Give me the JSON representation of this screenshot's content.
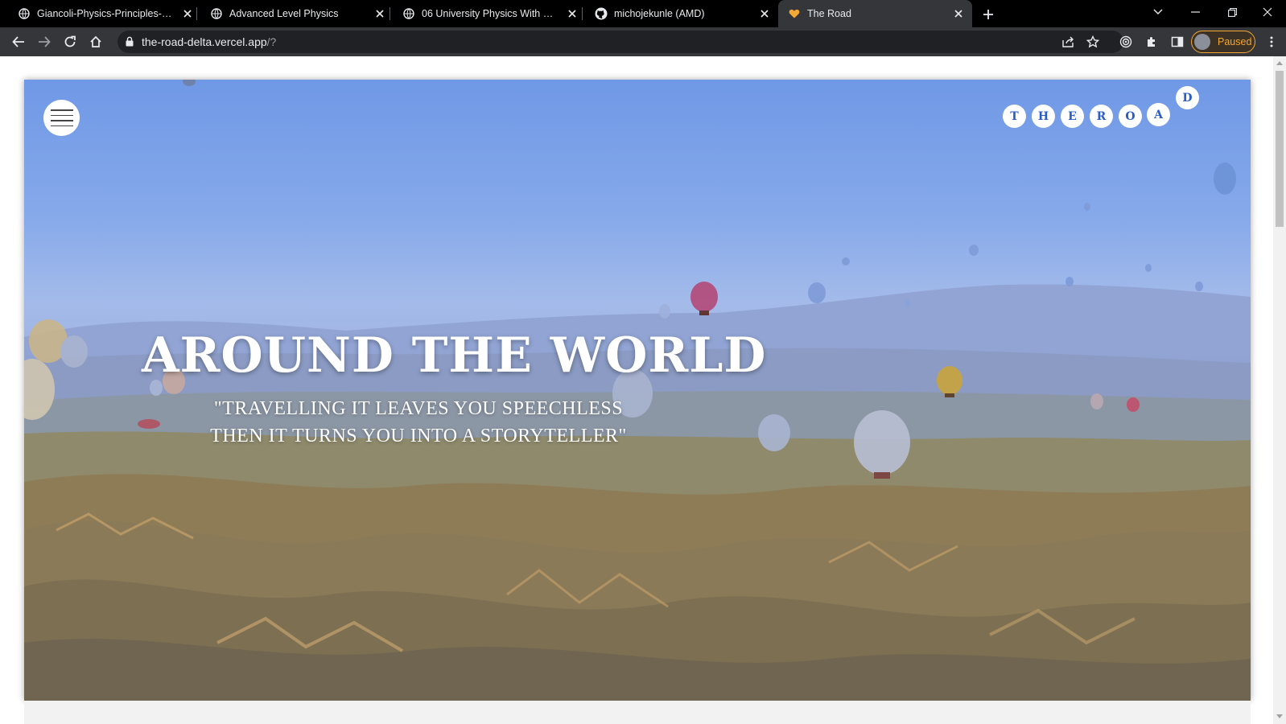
{
  "browser": {
    "tabs": [
      {
        "title": "Giancoli-Physics-Principles-with-",
        "icon": "globe-icon",
        "active": false
      },
      {
        "title": "Advanced Level Physics",
        "icon": "globe-icon",
        "active": false
      },
      {
        "title": "06 University Physics With Mode",
        "icon": "globe-icon",
        "active": false
      },
      {
        "title": "michojekunle (AMD)",
        "icon": "github-icon",
        "active": false
      },
      {
        "title": "The Road",
        "icon": "heart-icon",
        "active": true
      }
    ],
    "url_host": "the-road-delta.vercel.app",
    "url_path": "/?",
    "profile_label": "Paused",
    "colors": {
      "tabstrip": "#000000",
      "toolbar": "#35363a",
      "paused_accent": "#f3a735"
    }
  },
  "page": {
    "logo_letters": [
      "T",
      "H",
      "E",
      "R",
      "O",
      "A",
      "D"
    ],
    "headline": "AROUND THE WORLD",
    "quote_line1": "\"TRAVELLING IT LEAVES YOU SPEECHLESS",
    "quote_line2": "THEN IT TURNS YOU INTO A STORYTELLER\"",
    "colors": {
      "logo_text": "#2a5cc8",
      "sky": "#6f98e6"
    }
  }
}
